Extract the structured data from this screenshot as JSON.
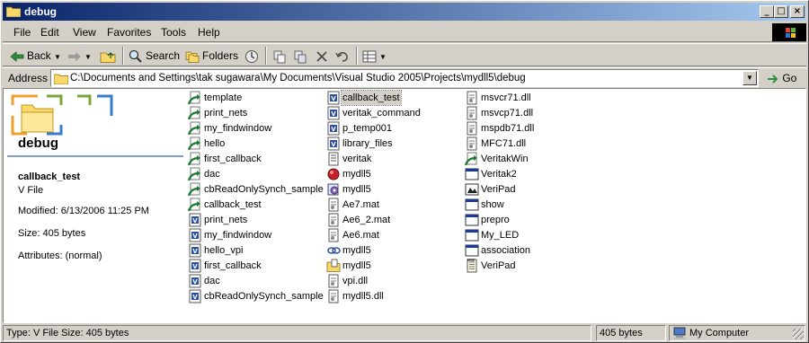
{
  "window": {
    "title": "debug"
  },
  "menu": [
    "File",
    "Edit",
    "View",
    "Favorites",
    "Tools",
    "Help"
  ],
  "toolbar": {
    "back": "Back",
    "search": "Search",
    "folders": "Folders"
  },
  "address": {
    "label": "Address",
    "path": "C:\\Documents and Settings\\tak sugawara\\My Documents\\Visual Studio 2005\\Projects\\mydll5\\debug",
    "go": "Go"
  },
  "details": {
    "folder": "debug",
    "name": "callback_test",
    "type": "V File",
    "modified": "Modified: 6/13/2006 11:25 PM",
    "size": "Size: 405 bytes",
    "attributes": "Attributes: (normal)"
  },
  "files": [
    [
      {
        "name": "template",
        "icon": "shortcut-icon"
      },
      {
        "name": "print_nets",
        "icon": "shortcut-icon"
      },
      {
        "name": "my_findwindow",
        "icon": "shortcut-icon"
      },
      {
        "name": "hello",
        "icon": "shortcut-icon"
      },
      {
        "name": "first_callback",
        "icon": "shortcut-icon"
      },
      {
        "name": "dac",
        "icon": "shortcut-icon"
      },
      {
        "name": "cbReadOnlySynch_sample",
        "icon": "shortcut-icon"
      },
      {
        "name": "callback_test",
        "icon": "shortcut-icon"
      },
      {
        "name": "print_nets",
        "icon": "vfile-icon"
      },
      {
        "name": "my_findwindow",
        "icon": "vfile-icon"
      },
      {
        "name": "hello_vpi",
        "icon": "vfile-icon"
      },
      {
        "name": "first_callback",
        "icon": "vfile-icon"
      },
      {
        "name": "dac",
        "icon": "vfile-icon"
      },
      {
        "name": "cbReadOnlySynch_sample",
        "icon": "vfile-icon"
      }
    ],
    [
      {
        "name": "callback_test",
        "icon": "vfile-icon",
        "selected": true
      },
      {
        "name": "veritak_command",
        "icon": "vfile-icon"
      },
      {
        "name": "p_temp001",
        "icon": "vfile-icon"
      },
      {
        "name": "library_files",
        "icon": "vfile-icon"
      },
      {
        "name": "veritak",
        "icon": "text-icon"
      },
      {
        "name": "mydll5",
        "icon": "red-ball-icon"
      },
      {
        "name": "mydll5",
        "icon": "gear-file-icon"
      },
      {
        "name": "Ae7.mat",
        "icon": "dll-file-icon"
      },
      {
        "name": "Ae6_2.mat",
        "icon": "dll-file-icon"
      },
      {
        "name": "Ae6.mat",
        "icon": "dll-file-icon"
      },
      {
        "name": "mydll5",
        "icon": "chain-icon"
      },
      {
        "name": "mydll5",
        "icon": "folder-doc-icon"
      },
      {
        "name": "vpi.dll",
        "icon": "dll-file-icon"
      },
      {
        "name": "mydll5.dll",
        "icon": "dll-file-icon"
      }
    ],
    [
      {
        "name": "msvcr71.dll",
        "icon": "dll-file-icon"
      },
      {
        "name": "msvcp71.dll",
        "icon": "dll-file-icon"
      },
      {
        "name": "mspdb71.dll",
        "icon": "dll-file-icon"
      },
      {
        "name": "MFC71.dll",
        "icon": "dll-file-icon"
      },
      {
        "name": "VeritakWin",
        "icon": "shortcut-icon"
      },
      {
        "name": "Veritak2",
        "icon": "window-icon"
      },
      {
        "name": "VeriPad",
        "icon": "gallery-icon"
      },
      {
        "name": "show",
        "icon": "window-icon"
      },
      {
        "name": "prepro",
        "icon": "window-icon"
      },
      {
        "name": "My_LED",
        "icon": "window-icon"
      },
      {
        "name": "association",
        "icon": "window-icon"
      },
      {
        "name": "VeriPad",
        "icon": "notepad-icon"
      }
    ]
  ],
  "status": {
    "left": "Type: V File Size: 405 bytes",
    "size": "405 bytes",
    "zone": "My Computer"
  }
}
